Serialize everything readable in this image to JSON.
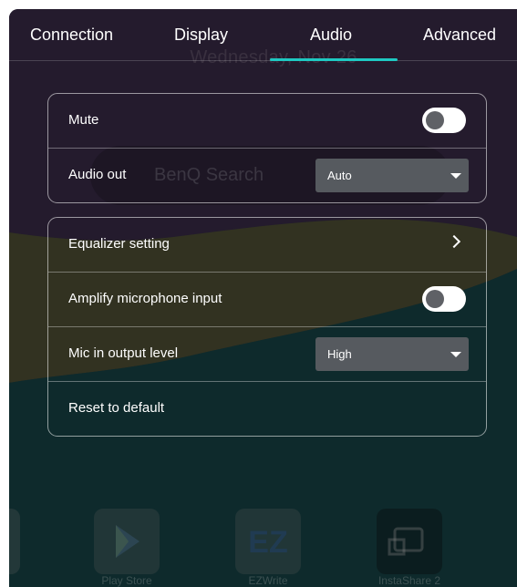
{
  "tabs": [
    {
      "label": "Connection"
    },
    {
      "label": "Display"
    },
    {
      "label": "Audio"
    },
    {
      "label": "Advanced"
    }
  ],
  "active_tab": "Audio",
  "background": {
    "date_text": "Wednesday, Nov 26",
    "search_text": "BenQ Search",
    "dock": [
      {
        "label": "Play Store",
        "icon": "play-store-icon"
      },
      {
        "label": "EZWrite",
        "icon": "ezwrite-icon"
      },
      {
        "label": "InstaShare 2",
        "icon": "instashare-icon"
      }
    ]
  },
  "audio_basic": {
    "mute": {
      "label": "Mute",
      "enabled": false
    },
    "audio_out": {
      "label": "Audio out",
      "value": "Auto"
    }
  },
  "audio_advanced": {
    "equalizer": {
      "label": "Equalizer setting"
    },
    "amplify_mic": {
      "label": "Amplify microphone input",
      "enabled": false
    },
    "mic_level": {
      "label": "Mic in output level",
      "value": "High"
    },
    "reset": {
      "label": "Reset to default"
    }
  },
  "colors": {
    "accent": "#1ec9c2",
    "toggle_track": "#ffffff",
    "toggle_knob": "#5f6166",
    "select_bg": "#565a5f"
  }
}
